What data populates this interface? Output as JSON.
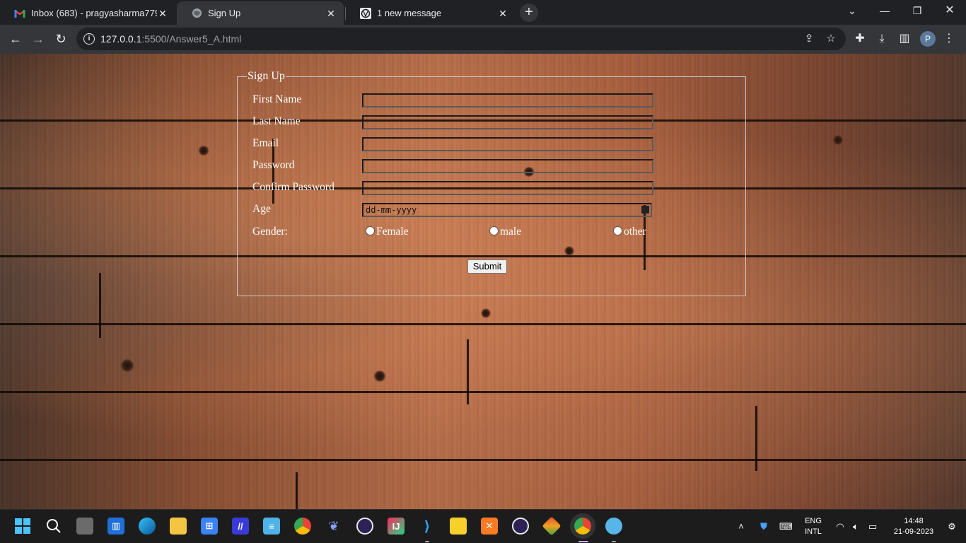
{
  "browser": {
    "tabs": [
      {
        "title": "Inbox (683) - pragyasharma7796",
        "favicon": "gmail-icon"
      },
      {
        "title": "Sign Up",
        "favicon": "globe-icon",
        "active": true
      },
      {
        "title": "1 new message",
        "favicon": "wordpress-icon"
      }
    ],
    "url_host": "127.0.0.1",
    "url_rest": ":5500/Answer5_A.html",
    "profile_initial": "P"
  },
  "form": {
    "legend": "Sign Up",
    "labels": {
      "first_name": "First Name",
      "last_name": "Last Name",
      "email": "Email",
      "password": "Password",
      "confirm_password": "Confirm Password",
      "age": "Age",
      "gender": "Gender:"
    },
    "age_placeholder": "dd-mm-yyyy",
    "gender_options": [
      "Female",
      "male",
      "other"
    ],
    "submit_label": "Submit"
  },
  "taskbar": {
    "lang_line1": "ENG",
    "lang_line2": "INTL",
    "time": "14:48",
    "date": "21-09-2023"
  }
}
